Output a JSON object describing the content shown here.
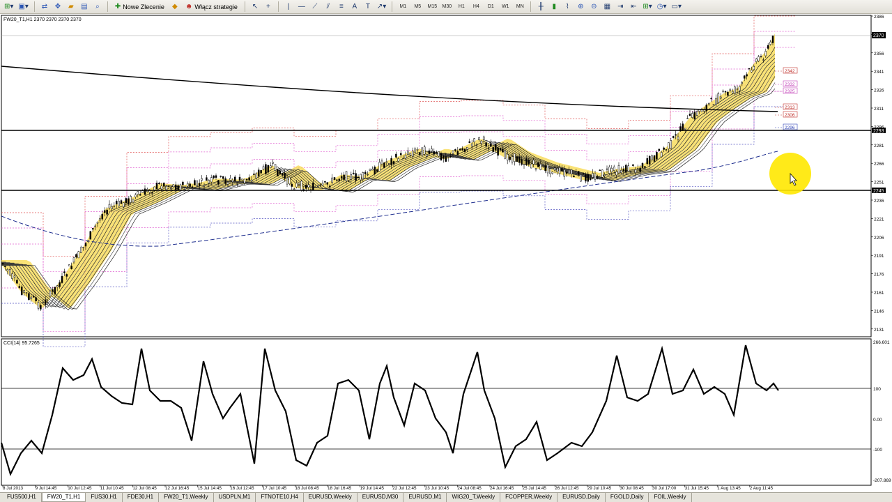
{
  "toolbar": {
    "new_order_label": "Nowe Zlecenie",
    "strategies_label": "Włącz strategie",
    "timeframes": [
      "M1",
      "M5",
      "M15",
      "M30",
      "H1",
      "H4",
      "D1",
      "W1",
      "MN"
    ]
  },
  "chart": {
    "info": "FW20_T1,H1  2370 2370 2370 2370",
    "price_ticks": [
      "2386",
      "2370",
      "2356",
      "2341",
      "2326",
      "2311",
      "2296",
      "2281",
      "2266",
      "2251",
      "2236",
      "2221",
      "2206",
      "2191",
      "2176",
      "2161",
      "2146",
      "2131"
    ],
    "current_price_label": "2370",
    "line_label_upper": "2293",
    "line_label_lower": "2245",
    "level_labels": [
      {
        "text": "2342",
        "color": "#c0302a"
      },
      {
        "text": "2332",
        "color": "#c03ab6"
      },
      {
        "text": "2325",
        "color": "#c03ab6"
      },
      {
        "text": "2313",
        "color": "#c0302a"
      },
      {
        "text": "2306",
        "color": "#c0302a"
      },
      {
        "text": "2296",
        "color": "#2a3fb5"
      }
    ],
    "colors": {
      "ribbon": "#f5d000",
      "band_red": "#e05050",
      "band_pink": "#e060d0",
      "band_blue": "#5050c0",
      "dashed": "#1f2f8f"
    }
  },
  "cci": {
    "label": "CCI(14) 95.7265",
    "ticks": [
      "266.601",
      "100",
      "0.00",
      "-100",
      "-207.869"
    ]
  },
  "time_axis": [
    "8 Jul 2013",
    "9 Jul 14:45",
    "10 Jul 12:45",
    "11 Jul 10:45",
    "12 Jul 08:45",
    "12 Jul 16:45",
    "15 Jul 14:45",
    "16 Jul 12:45",
    "17 Jul 10:45",
    "18 Jul 08:45",
    "18 Jul 16:45",
    "19 Jul 14:45",
    "22 Jul 12:45",
    "23 Jul 10:45",
    "24 Jul 08:45",
    "24 Jul 16:45",
    "25 Jul 14:45",
    "26 Jul 12:45",
    "29 Jul 10:45",
    "30 Jul 08:45",
    "30 Jul 17:00",
    "31 Jul 15:45",
    "1 Aug 13:45",
    "2 Aug 11:45"
  ],
  "tabs": [
    "FUS500,H1",
    "FW20_T1,H1",
    "FUS30,H1",
    "FDE30,H1",
    "FW20_T1,Weekly",
    "USDPLN,M1",
    "FTNOTE10,H4",
    "EURUSD,Weekly",
    "EURUSD,M30",
    "EURUSD,M1",
    "WIG20_T,Weekly",
    "FCOPPER,Weekly",
    "EURUSD,Daily",
    "FGOLD,Daily",
    "FOIL,Weekly"
  ],
  "active_tab": 1
}
